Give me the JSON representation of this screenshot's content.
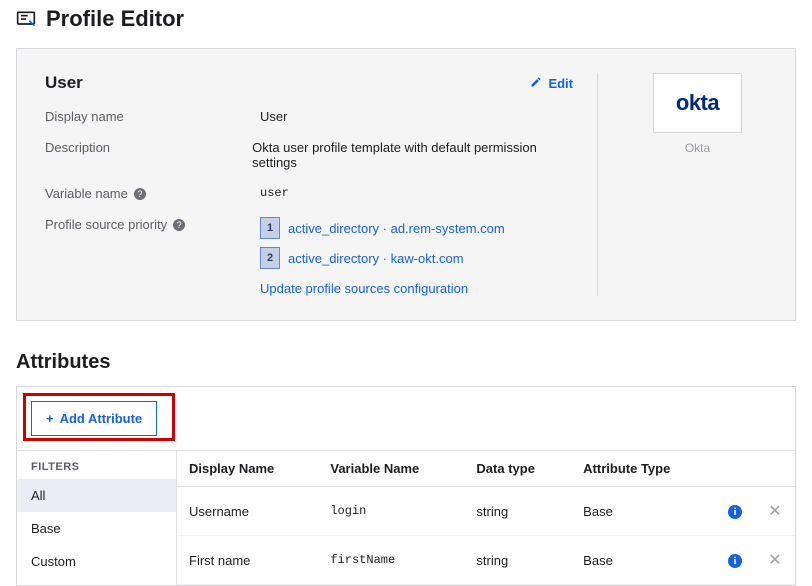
{
  "page_title": "Profile Editor",
  "user_panel": {
    "heading": "User",
    "edit_label": "Edit",
    "rows": {
      "display_name": {
        "label": "Display name",
        "value": "User"
      },
      "description": {
        "label": "Description",
        "value": "Okta user profile template with default permission settings"
      },
      "variable_name": {
        "label": "Variable name",
        "value": "user"
      },
      "profile_priority": {
        "label": "Profile source priority"
      }
    },
    "priority_sources": [
      {
        "num": "1",
        "text": "active_directory · ad.rem-system.com"
      },
      {
        "num": "2",
        "text": "active_directory · kaw-okt.com"
      }
    ],
    "update_link": "Update profile sources configuration"
  },
  "brand": {
    "logo": "okta",
    "label": "Okta"
  },
  "attributes": {
    "heading": "Attributes",
    "add_button": "Add Attribute",
    "filters_heading": "FILTERS",
    "filters": [
      "All",
      "Base",
      "Custom"
    ],
    "columns": [
      "Display Name",
      "Variable Name",
      "Data type",
      "Attribute Type"
    ],
    "rows": [
      {
        "display": "Username",
        "var": "login",
        "type": "string",
        "attr": "Base"
      },
      {
        "display": "First name",
        "var": "firstName",
        "type": "string",
        "attr": "Base"
      }
    ]
  }
}
